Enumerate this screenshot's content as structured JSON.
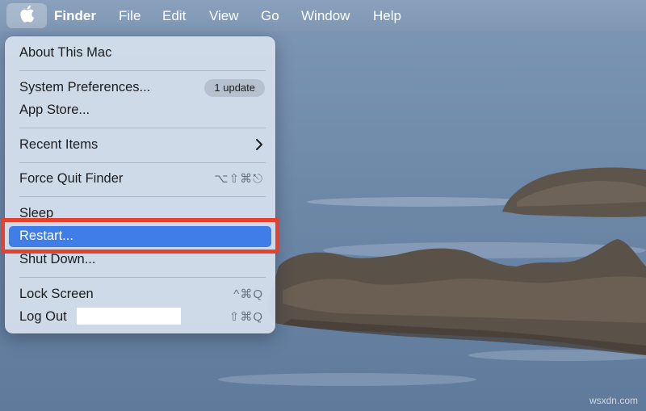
{
  "menubar": {
    "apple_icon": "apple-logo-icon",
    "items": [
      {
        "label": "Finder"
      },
      {
        "label": "File"
      },
      {
        "label": "Edit"
      },
      {
        "label": "View"
      },
      {
        "label": "Go"
      },
      {
        "label": "Window"
      },
      {
        "label": "Help"
      }
    ]
  },
  "apple_menu": {
    "about": "About This Mac",
    "system_prefs": "System Preferences...",
    "update_badge": "1 update",
    "app_store": "App Store...",
    "recent_items": "Recent Items",
    "force_quit": "Force Quit Finder",
    "force_quit_shortcut": "⌥⇧⌘⎋",
    "sleep": "Sleep",
    "restart": "Restart...",
    "shut_down": "Shut Down...",
    "lock_screen": "Lock Screen",
    "lock_screen_shortcut": "^⌘Q",
    "log_out": "Log Out",
    "log_out_shortcut": "⇧⌘Q"
  },
  "colors": {
    "highlight": "#3f7ee8",
    "annotation": "#e4412f"
  },
  "watermark": "wsxdn.com"
}
